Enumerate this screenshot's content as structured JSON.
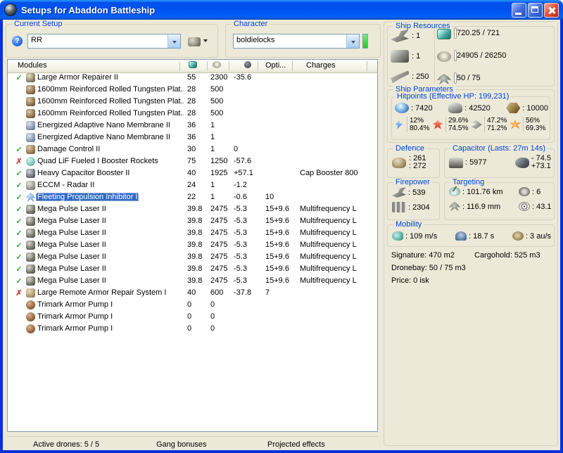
{
  "colors": {
    "selection": "#316AC5",
    "group_label": "#0046D5",
    "progress_green": "#5FD373",
    "status_indicator_green": "#3ED43E",
    "check_ok": "#2FAF2F",
    "check_bad": "#D03A3A",
    "titlebar_blue": "#0053EE"
  },
  "window": {
    "title": "Setups for Abaddon Battleship"
  },
  "setup": {
    "label": "Current Setup",
    "help_glyph": "?",
    "value": "RR"
  },
  "character": {
    "label": "Character",
    "value": "boldielocks"
  },
  "modules": {
    "glyphs": {
      "ok": "✓",
      "bad": "✗"
    },
    "header": {
      "name": "Modules",
      "opti": "Opti...",
      "charges": "Charges",
      "icons": [
        "cpu-chip",
        "powergrid",
        "capacitor"
      ]
    },
    "rows": [
      {
        "state": "ok",
        "icon": "armor-repairer",
        "name": "Large Armor Repairer II",
        "cpu": "55",
        "pg": "2300",
        "cap": "-35.6",
        "opti": "",
        "charge": ""
      },
      {
        "state": "",
        "icon": "armor-plate",
        "name": "1600mm Reinforced Rolled Tungsten Plat...",
        "cpu": "28",
        "pg": "500",
        "cap": "",
        "opti": "",
        "charge": ""
      },
      {
        "state": "",
        "icon": "armor-plate",
        "name": "1600mm Reinforced Rolled Tungsten Plat...",
        "cpu": "28",
        "pg": "500",
        "cap": "",
        "opti": "",
        "charge": ""
      },
      {
        "state": "",
        "icon": "armor-plate",
        "name": "1600mm Reinforced Rolled Tungsten Plat...",
        "cpu": "28",
        "pg": "500",
        "cap": "",
        "opti": "",
        "charge": ""
      },
      {
        "state": "",
        "icon": "nano-membrane",
        "name": "Energized Adaptive Nano Membrane II",
        "cpu": "36",
        "pg": "1",
        "cap": "",
        "opti": "",
        "charge": ""
      },
      {
        "state": "",
        "icon": "nano-membrane",
        "name": "Energized Adaptive Nano Membrane II",
        "cpu": "36",
        "pg": "1",
        "cap": "",
        "opti": "",
        "charge": ""
      },
      {
        "state": "ok",
        "icon": "damage-control",
        "name": "Damage Control II",
        "cpu": "30",
        "pg": "1",
        "cap": "0",
        "opti": "",
        "charge": ""
      },
      {
        "state": "bad",
        "icon": "booster-rockets",
        "name": "Quad LiF Fueled I Booster Rockets",
        "cpu": "75",
        "pg": "1250",
        "cap": "-57.6",
        "opti": "",
        "charge": ""
      },
      {
        "state": "ok",
        "icon": "cap-booster",
        "name": "Heavy Capacitor Booster II",
        "cpu": "40",
        "pg": "1925",
        "cap": "+57.1",
        "opti": "",
        "charge": "Cap Booster 800"
      },
      {
        "state": "ok",
        "icon": "eccm",
        "name": "ECCM - Radar II",
        "cpu": "24",
        "pg": "1",
        "cap": "-1.2",
        "opti": "",
        "charge": ""
      },
      {
        "state": "ok",
        "icon": "stasis-web",
        "name": "Fleeting Propulsion Inhibitor I",
        "cpu": "22",
        "pg": "1",
        "cap": "-0.6",
        "opti": "10",
        "charge": "",
        "selected": true
      },
      {
        "state": "ok",
        "icon": "laser-turret",
        "name": "Mega Pulse Laser II",
        "cpu": "39.8",
        "pg": "2475",
        "cap": "-5.3",
        "opti": "15+9.6",
        "charge": "Multifrequency L"
      },
      {
        "state": "ok",
        "icon": "laser-turret",
        "name": "Mega Pulse Laser II",
        "cpu": "39.8",
        "pg": "2475",
        "cap": "-5.3",
        "opti": "15+9.6",
        "charge": "Multifrequency L"
      },
      {
        "state": "ok",
        "icon": "laser-turret",
        "name": "Mega Pulse Laser II",
        "cpu": "39.8",
        "pg": "2475",
        "cap": "-5.3",
        "opti": "15+9.6",
        "charge": "Multifrequency L"
      },
      {
        "state": "ok",
        "icon": "laser-turret",
        "name": "Mega Pulse Laser II",
        "cpu": "39.8",
        "pg": "2475",
        "cap": "-5.3",
        "opti": "15+9.6",
        "charge": "Multifrequency L"
      },
      {
        "state": "ok",
        "icon": "laser-turret",
        "name": "Mega Pulse Laser II",
        "cpu": "39.8",
        "pg": "2475",
        "cap": "-5.3",
        "opti": "15+9.6",
        "charge": "Multifrequency L"
      },
      {
        "state": "ok",
        "icon": "laser-turret",
        "name": "Mega Pulse Laser II",
        "cpu": "39.8",
        "pg": "2475",
        "cap": "-5.3",
        "opti": "15+9.6",
        "charge": "Multifrequency L"
      },
      {
        "state": "ok",
        "icon": "laser-turret",
        "name": "Mega Pulse Laser II",
        "cpu": "39.8",
        "pg": "2475",
        "cap": "-5.3",
        "opti": "15+9.6",
        "charge": "Multifrequency L"
      },
      {
        "state": "bad",
        "icon": "remote-repairer",
        "name": "Large Remote Armor Repair System I",
        "cpu": "40",
        "pg": "600",
        "cap": "-37.8",
        "opti": "7",
        "charge": ""
      },
      {
        "state": "",
        "icon": "rig",
        "name": "Trimark Armor Pump I",
        "cpu": "0",
        "pg": "0",
        "cap": "",
        "opti": "",
        "charge": ""
      },
      {
        "state": "",
        "icon": "rig",
        "name": "Trimark Armor Pump I",
        "cpu": "0",
        "pg": "0",
        "cap": "",
        "opti": "",
        "charge": ""
      },
      {
        "state": "",
        "icon": "rig",
        "name": "Trimark Armor Pump I",
        "cpu": "0",
        "pg": "0",
        "cap": "",
        "opti": "",
        "charge": ""
      }
    ]
  },
  "resources": {
    "title": "Ship Resources",
    "slots": [
      {
        "icon": "turret-hardpoint",
        "value": ": 1"
      },
      {
        "icon": "launcher-hardpoint",
        "value": ": 1"
      },
      {
        "icon": "calibration",
        "value": ": 250"
      }
    ],
    "bars": [
      {
        "icon": "cpu-chip",
        "text": "720.25 / 721",
        "pct": 100
      },
      {
        "icon": "powergrid",
        "text": "24905 / 26250",
        "pct": 95
      },
      {
        "icon": "drone-bandwidth",
        "text": "50 / 75",
        "pct": 67
      }
    ]
  },
  "parameters": {
    "title": "Ship Parameters",
    "hitpoints": {
      "title": "Hitpoints (Effective HP: 199,231)",
      "shield": ": 7420",
      "armor": ": 42520",
      "hull": ": 10000",
      "resists": [
        {
          "type": "em",
          "shield": "12%",
          "armor": "80.4%"
        },
        {
          "type": "thermal",
          "shield": "29.6%",
          "armor": "74.5%"
        },
        {
          "type": "kinetic",
          "shield": "47.2%",
          "armor": "71.2%"
        },
        {
          "type": "explosive",
          "shield": "56%",
          "armor": "69.3%"
        }
      ]
    },
    "defence": {
      "title": "Defence",
      "top": ": 261",
      "bottom": ": 272"
    },
    "capacitor": {
      "title": "Capacitor (Lasts: 27m 14s)",
      "amount": ": 5977",
      "peak_drain": "- 74.5",
      "recharge": "+73.1"
    },
    "firepower": {
      "title": "Firepower",
      "dps": ": 539",
      "volley": ": 2304"
    },
    "targeting": {
      "title": "Targeting",
      "range": ": 101.76 km",
      "max_targets": ": 6",
      "signature": ": 116.9 mm",
      "scan_res": ": 43.1"
    },
    "mobility": {
      "title": "Mobility",
      "speed": ": 109 m/s",
      "align_time": ": 18.7 s",
      "warp": ": 3 au/s"
    },
    "stats": {
      "signature": "Signature: 470 m2",
      "cargohold": "Cargohold: 525 m3",
      "dronebay": "Dronebay: 50 / 75 m3",
      "price": "Price: 0 isk"
    }
  },
  "footer": {
    "active_drones": "Active drones: 5 / 5",
    "gang_bonuses": "Gang bonuses",
    "projected_effects": "Projected effects"
  }
}
